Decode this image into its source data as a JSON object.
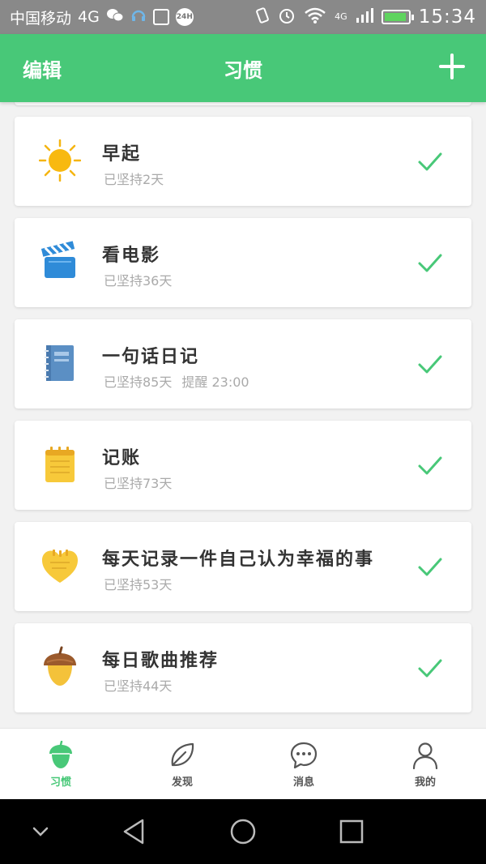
{
  "status_bar": {
    "carrier": "中国移动",
    "network_left": "4G",
    "clock_badge": "24H",
    "network_right": "4G",
    "time": "15:34"
  },
  "header": {
    "edit_label": "编辑",
    "title": "习惯",
    "add_icon": "plus-icon"
  },
  "habits": [
    {
      "name": "早起",
      "streak": "已坚持2天",
      "reminder": "",
      "icon": "sun-icon"
    },
    {
      "name": "看电影",
      "streak": "已坚持36天",
      "reminder": "",
      "icon": "clapperboard-icon"
    },
    {
      "name": "一句话日记",
      "streak": "已坚持85天",
      "reminder": "提醒 23:00",
      "icon": "notebook-icon"
    },
    {
      "name": "记账",
      "streak": "已坚持73天",
      "reminder": "",
      "icon": "notepad-icon"
    },
    {
      "name": "每天记录一件自己认为幸福的事",
      "streak": "已坚持53天",
      "reminder": "",
      "icon": "heart-note-icon"
    },
    {
      "name": "每日歌曲推荐",
      "streak": "已坚持44天",
      "reminder": "",
      "icon": "acorn-icon"
    }
  ],
  "bottom_nav": [
    {
      "label": "习惯",
      "icon": "acorn-icon",
      "active": true
    },
    {
      "label": "发现",
      "icon": "leaf-icon",
      "active": false
    },
    {
      "label": "消息",
      "icon": "chat-bubble-icon",
      "active": false
    },
    {
      "label": "我的",
      "icon": "person-icon",
      "active": false
    }
  ],
  "colors": {
    "accent": "#48c878",
    "status_bar": "#898989",
    "background": "#f2f2f2",
    "check": "#48c878"
  }
}
